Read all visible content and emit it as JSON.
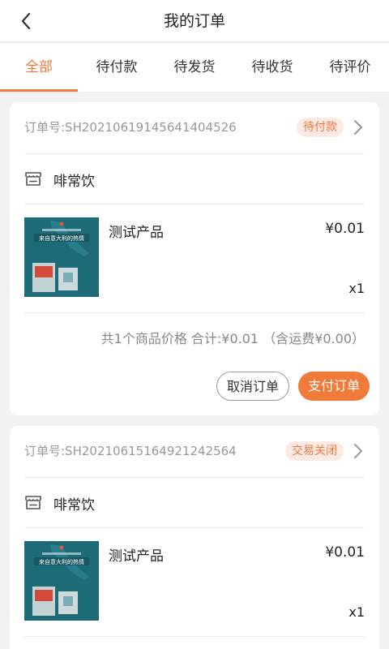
{
  "header": {
    "title": "我的订单",
    "back_icon": "chevron-left-icon"
  },
  "tabs": [
    {
      "label": "全部",
      "active": true
    },
    {
      "label": "待付款",
      "active": false
    },
    {
      "label": "待发货",
      "active": false
    },
    {
      "label": "待收货",
      "active": false
    },
    {
      "label": "待评价",
      "active": false
    }
  ],
  "orders": [
    {
      "order_no": "订单号:SH20210619145641404526",
      "status": "待付款",
      "shop_name": "啡常饮",
      "product": {
        "name": "测试产品",
        "price": "¥0.01",
        "qty": "x1",
        "image_text": "来自意大利的热情"
      },
      "summary": "共1个商品价格  合计:¥0.01 （含运费¥0.00）",
      "actions": {
        "cancel": "取消订单",
        "pay": "支付订单"
      }
    },
    {
      "order_no": "订单号:SH20210615164921242564",
      "status": "交易关闭",
      "shop_name": "啡常饮",
      "product": {
        "name": "测试产品",
        "price": "¥0.01",
        "qty": "x1",
        "image_text": "来自意大利的热情"
      }
    }
  ],
  "colors": {
    "accent": "#f07a3a",
    "badge_bg": "#fde9e3",
    "page_bg": "#f2f2f2"
  }
}
